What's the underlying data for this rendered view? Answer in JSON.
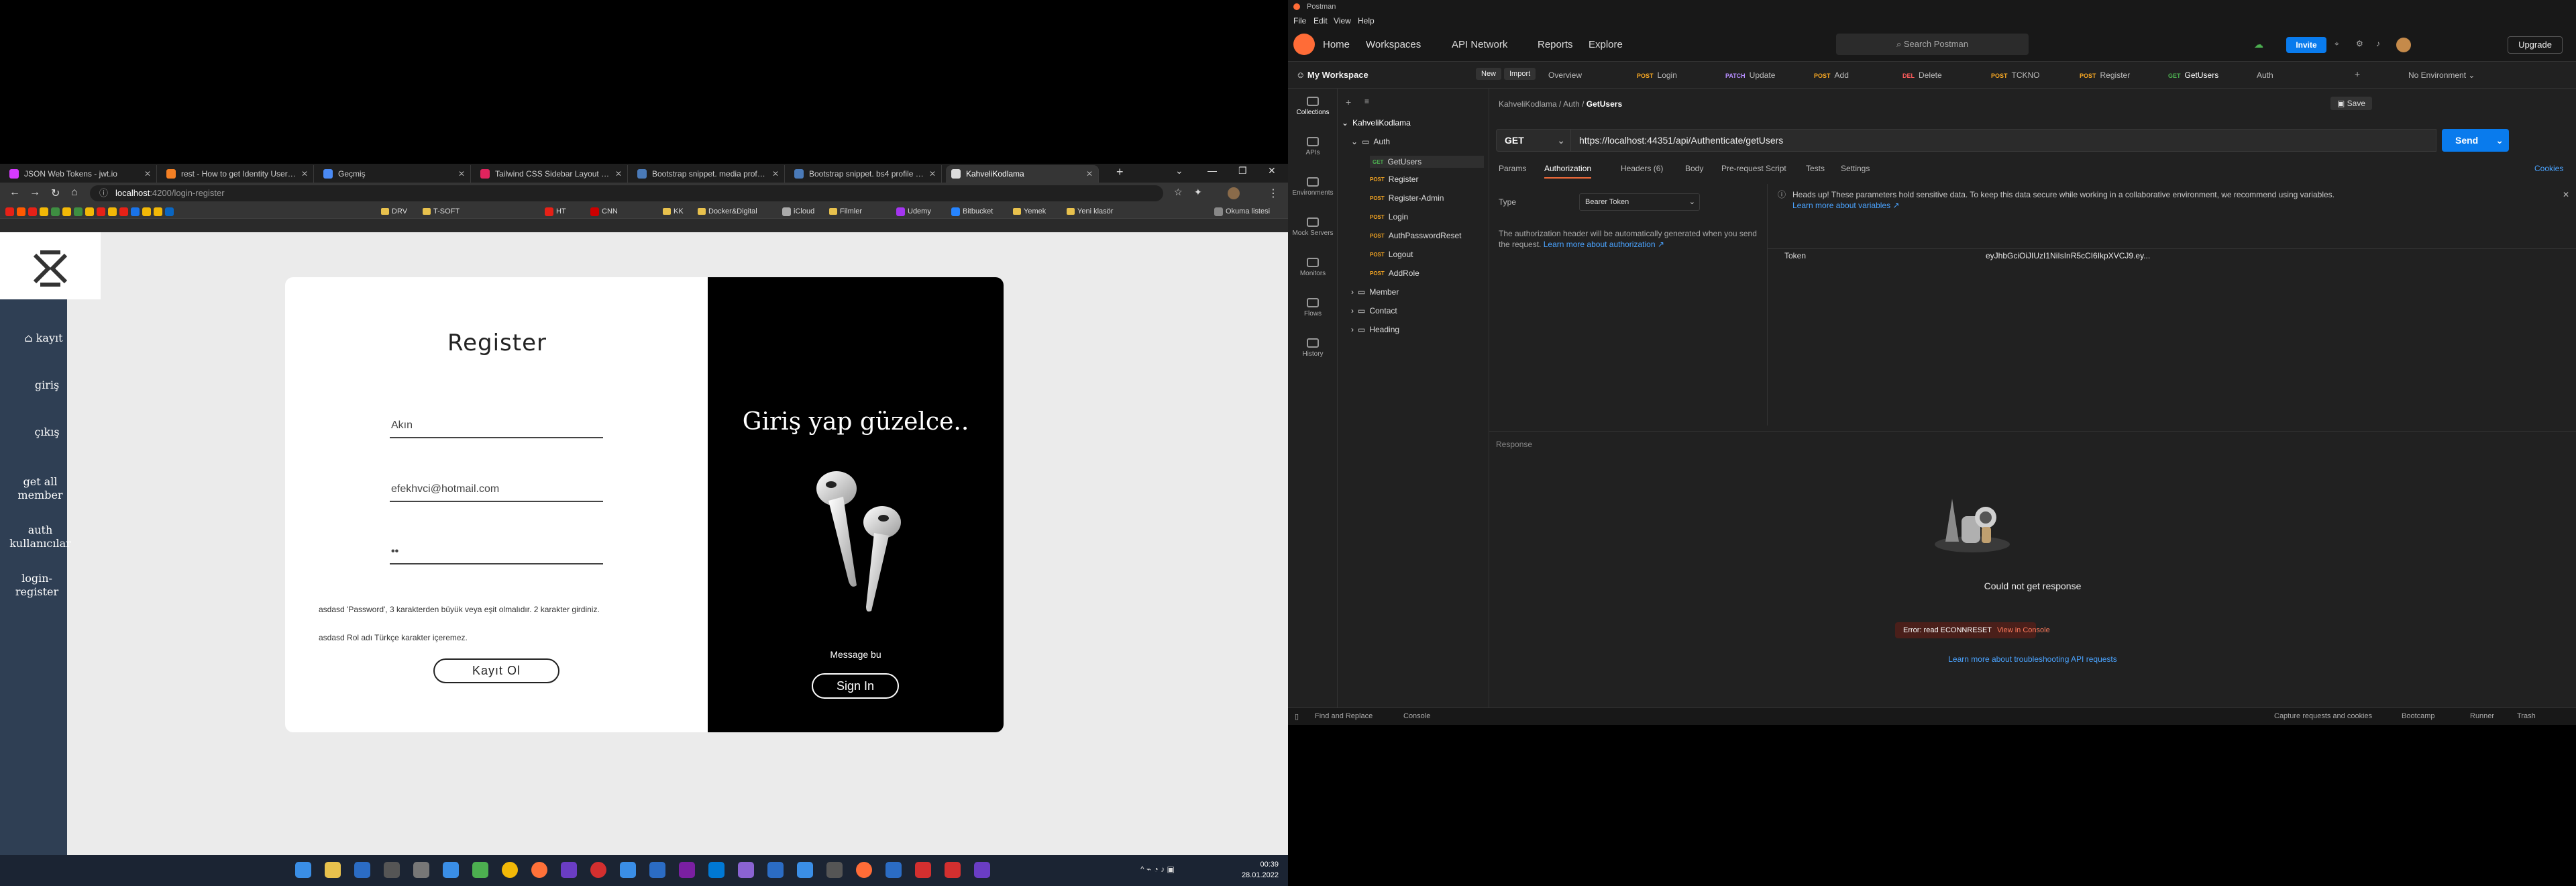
{
  "browser": {
    "tabs": [
      {
        "label": "JSON Web Tokens - jwt.io",
        "favicon_color": "#d63aff"
      },
      {
        "label": "rest - How to get Identity User f...",
        "favicon_color": "#f48024"
      },
      {
        "label": "Geçmiş",
        "favicon_color": "#4a8af4"
      },
      {
        "label": "Tailwind CSS Sidebar Layout - T...",
        "favicon_color": "#e0245e"
      },
      {
        "label": "Bootstrap snippet. media profile...",
        "favicon_color": "#4a7ab8"
      },
      {
        "label": "Bootstrap snippet. bs4 profile wi...",
        "favicon_color": "#4a7ab8"
      },
      {
        "label": "KahveliKodlama",
        "favicon_color": "#dddddd"
      }
    ],
    "url_host": "localhost",
    "url_path": ":4200/login-register",
    "bookmarks": [
      "DRV",
      "T-SOFT",
      "HT",
      "CNN",
      "KK",
      "Docker&Digital",
      "iCloud",
      "Filmler",
      "Udemy",
      "Bitbucket",
      "Yemek",
      "Yeni klasör",
      "Okuma listesi"
    ]
  },
  "app": {
    "sidebar": [
      "kayıt",
      "giriş",
      "çıkış",
      "get all member",
      "auth kullanıcılar",
      "login-register"
    ],
    "register": {
      "title": "Register",
      "name_value": "Akın",
      "email_value": "efekhvci@hotmail.com",
      "password_value": "••",
      "note1": "asdasd 'Password', 3 karakterden büyük veya eşit olmalıdır. 2 karakter girdiniz.",
      "note2": "asdasd Rol adı Türkçe karakter içeremez.",
      "button": "Kayıt Ol"
    },
    "promo": {
      "title": "Giriş yap güzelce..",
      "message": "Message bu",
      "button": "Sign In"
    }
  },
  "taskbar": {
    "time": "00:39",
    "date": "28.01.2022"
  },
  "postman": {
    "window_title": "Postman",
    "menu": [
      "File",
      "Edit",
      "View",
      "Help"
    ],
    "top_nav": [
      "Home",
      "Workspaces",
      "API Network",
      "Reports",
      "Explore"
    ],
    "search_placeholder": "Search Postman",
    "invite": "Invite",
    "upgrade": "Upgrade",
    "workspace": "My Workspace",
    "new_btn": "New",
    "import_btn": "Import",
    "env": "No Environment",
    "request_tabs": [
      {
        "method": "",
        "label": "Overview",
        "color": "#bbbbbb"
      },
      {
        "method": "POST",
        "label": "Login",
        "color": "#f5a623"
      },
      {
        "method": "PATCH",
        "label": "Update",
        "color": "#b68dff"
      },
      {
        "method": "POST",
        "label": "Add",
        "color": "#f5a623"
      },
      {
        "method": "DEL",
        "label": "Delete",
        "color": "#ff5c5c"
      },
      {
        "method": "POST",
        "label": "TCKNO",
        "color": "#f5a623"
      },
      {
        "method": "POST",
        "label": "Register",
        "color": "#f5a623"
      },
      {
        "method": "GET",
        "label": "GetUsers",
        "color": "#4caf50"
      },
      {
        "method": "",
        "label": "Auth",
        "color": "#bbbbbb"
      }
    ],
    "rail": [
      "Collections",
      "APIs",
      "Environments",
      "Mock Servers",
      "Monitors",
      "Flows",
      "History"
    ],
    "collection": {
      "name": "KahveliKodlama",
      "auth_folder": "Auth",
      "auth_items": [
        {
          "method": "GET",
          "label": "GetUsers"
        },
        {
          "method": "POST",
          "label": "Register"
        },
        {
          "method": "POST",
          "label": "Register-Admin"
        },
        {
          "method": "POST",
          "label": "Login"
        },
        {
          "method": "POST",
          "label": "AuthPasswordReset"
        },
        {
          "method": "POST",
          "label": "Logout"
        },
        {
          "method": "POST",
          "label": "AddRole"
        }
      ],
      "folders": [
        "Member",
        "Contact",
        "Heading"
      ]
    },
    "breadcrumb": [
      "KahveliKodlama",
      "Auth",
      "GetUsers"
    ],
    "save": "Save",
    "method": "GET",
    "url": "https://localhost:44351/api/Authenticate/getUsers",
    "send": "Send",
    "sub_tabs": [
      "Params",
      "Authorization",
      "Headers (6)",
      "Body",
      "Pre-request Script",
      "Tests",
      "Settings"
    ],
    "cookies": "Cookies",
    "auth_type_label": "Type",
    "auth_type_value": "Bearer Token",
    "auth_desc": "The authorization header will be automatically generated when you send the request.",
    "auth_learn": "Learn more about authorization ↗",
    "alert": "Heads up! These parameters hold sensitive data. To keep this data secure while working in a collaborative environment, we recommend using variables.",
    "alert_link": "Learn more about variables ↗",
    "token_label": "Token",
    "token_value": "eyJhbGciOiJIUzI1NiIsInR5cCI6IkpXVCJ9.ey...",
    "response_label": "Response",
    "no_response": "Could not get response",
    "error": "Error: read ECONNRESET",
    "view_console": "View in Console",
    "troubleshoot": "Learn more about troubleshooting API requests",
    "status_left": [
      "Find and Replace",
      "Console"
    ],
    "status_right": [
      "Capture requests and cookies",
      "Bootcamp",
      "Runner",
      "Trash"
    ]
  }
}
